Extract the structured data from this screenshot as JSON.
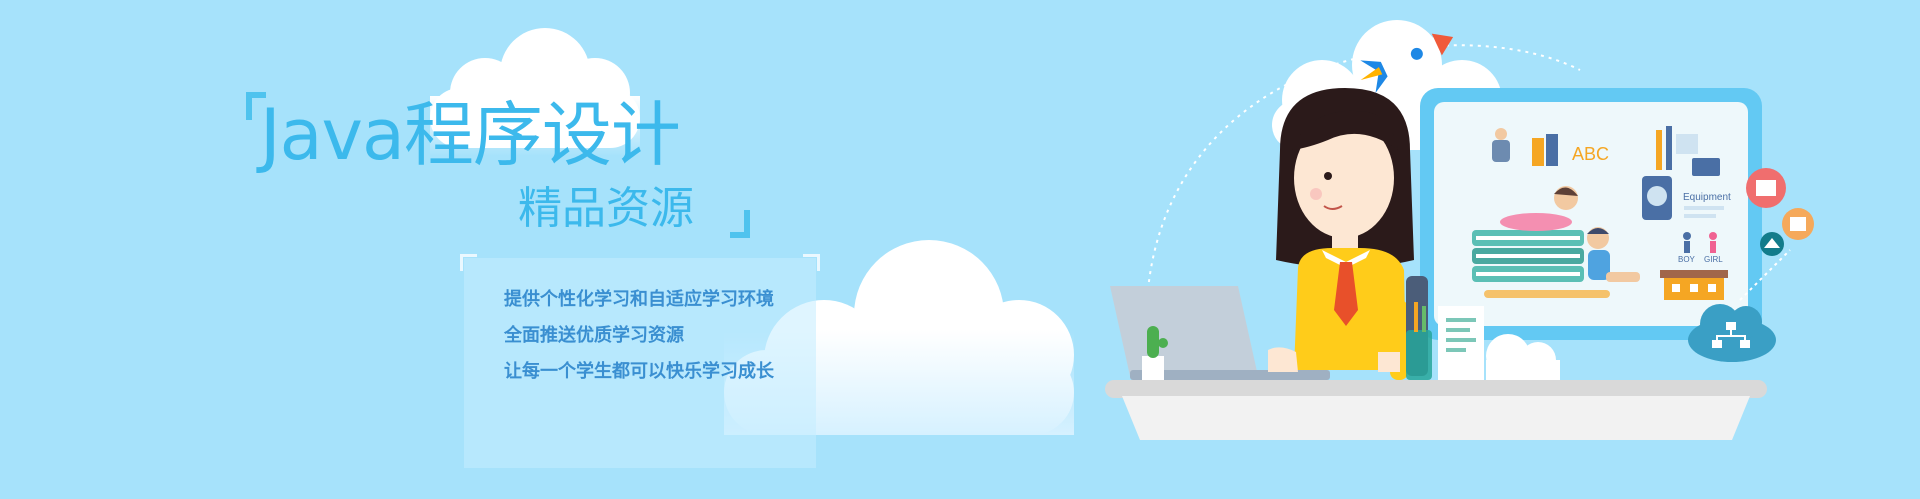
{
  "banner": {
    "title": "Java程序设计",
    "subtitle": "精品资源",
    "features": [
      "提供个性化学习和自适应学习环境",
      "全面推送优质学习资源",
      "让每一个学生都可以快乐学习成长"
    ]
  },
  "illustration": {
    "labels": {
      "abc": "ABC",
      "equipment": "Equipment",
      "boy": "BOY",
      "girl": "GIRL"
    }
  },
  "colors": {
    "background": "#a6e2fb",
    "title": "#3cb9ec",
    "feature_text": "#3a8fd1",
    "board_frame": "#63c9f3",
    "shirt": "#ffcc1a",
    "tie": "#e8502a"
  },
  "icons": [
    "rocket-icon",
    "newspaper-icon",
    "calendar-icon",
    "school-icon",
    "network-cloud-icon",
    "cactus-icon",
    "pencil-cup-icon"
  ]
}
